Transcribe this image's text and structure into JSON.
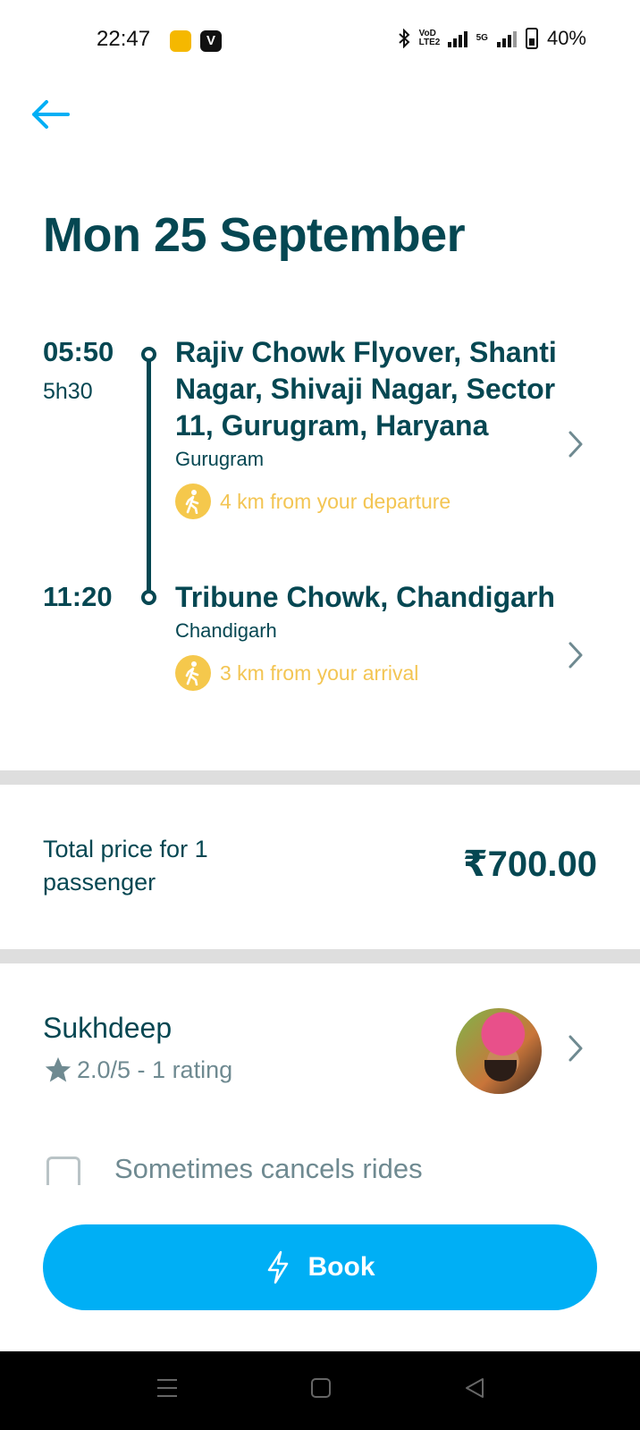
{
  "status_bar": {
    "time": "22:47",
    "badge_v": "V",
    "network_volte": "VoD LTE2",
    "network_5g": "5G",
    "battery": "40%"
  },
  "header": {
    "back_icon": "arrow-left-icon",
    "date": "Mon 25 September"
  },
  "itinerary": {
    "departure": {
      "time": "05:50",
      "duration": "5h30",
      "address": "Rajiv Chowk Flyover, Shanti Nagar, Shivaji Nagar, Sector 11, Gurugram, Haryana",
      "city": "Gurugram",
      "walk_distance": "4 km from your departure"
    },
    "arrival": {
      "time": "11:20",
      "address": "Tribune Chowk, Chandigarh",
      "city": "Chandigarh",
      "walk_distance": "3 km from your arrival"
    }
  },
  "price": {
    "label": "Total price for 1 passenger",
    "value": "₹700.00"
  },
  "driver": {
    "name": "Sukhdeep",
    "rating": "2.0/5 - 1 rating",
    "note": "Sometimes cancels rides"
  },
  "actions": {
    "book_label": "Book"
  },
  "colors": {
    "primary_text": "#054752",
    "accent_blue": "#00aff5",
    "walk_yellow": "#f3c553",
    "muted": "#6f8a91"
  }
}
